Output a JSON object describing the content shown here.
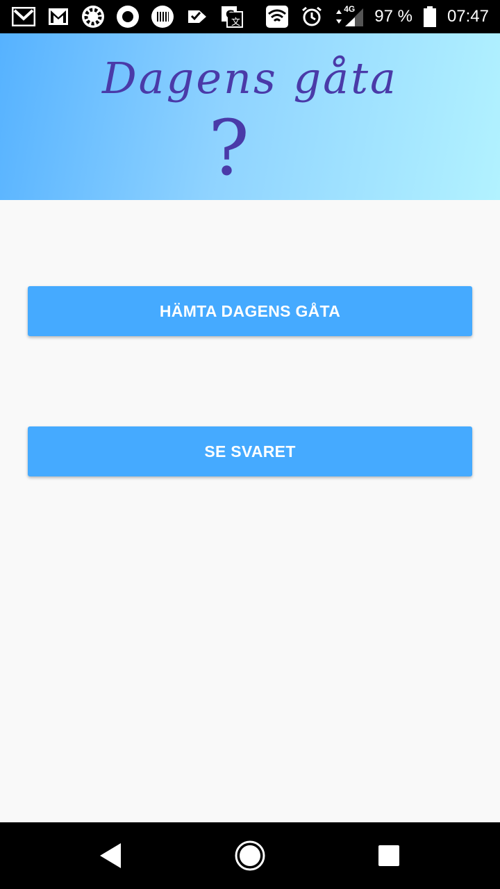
{
  "status_bar": {
    "battery_text": "97 %",
    "time": "07:47",
    "network_label": "4G",
    "left_icons": [
      "gmail-icon",
      "gmail-icon",
      "ring-icon",
      "circle-icon",
      "barcode-icon",
      "check-tag-icon",
      "translate-icon"
    ],
    "right_icons": [
      "wifi-icon",
      "alarm-icon",
      "data-arrows-icon",
      "signal-icon",
      "battery-icon"
    ]
  },
  "header": {
    "title": "Dagens gåta",
    "mark": "?"
  },
  "buttons": {
    "fetch_label": "HÄMTA DAGENS GÅTA",
    "answer_label": "SE SVARET"
  },
  "nav_bar": {
    "icons": [
      "back-icon",
      "home-icon",
      "recents-icon"
    ]
  },
  "colors": {
    "accent": "#45aaff",
    "title_color": "#4a3aa8",
    "header_gradient_start": "#56b2ff",
    "header_gradient_end": "#b2f2ff"
  }
}
